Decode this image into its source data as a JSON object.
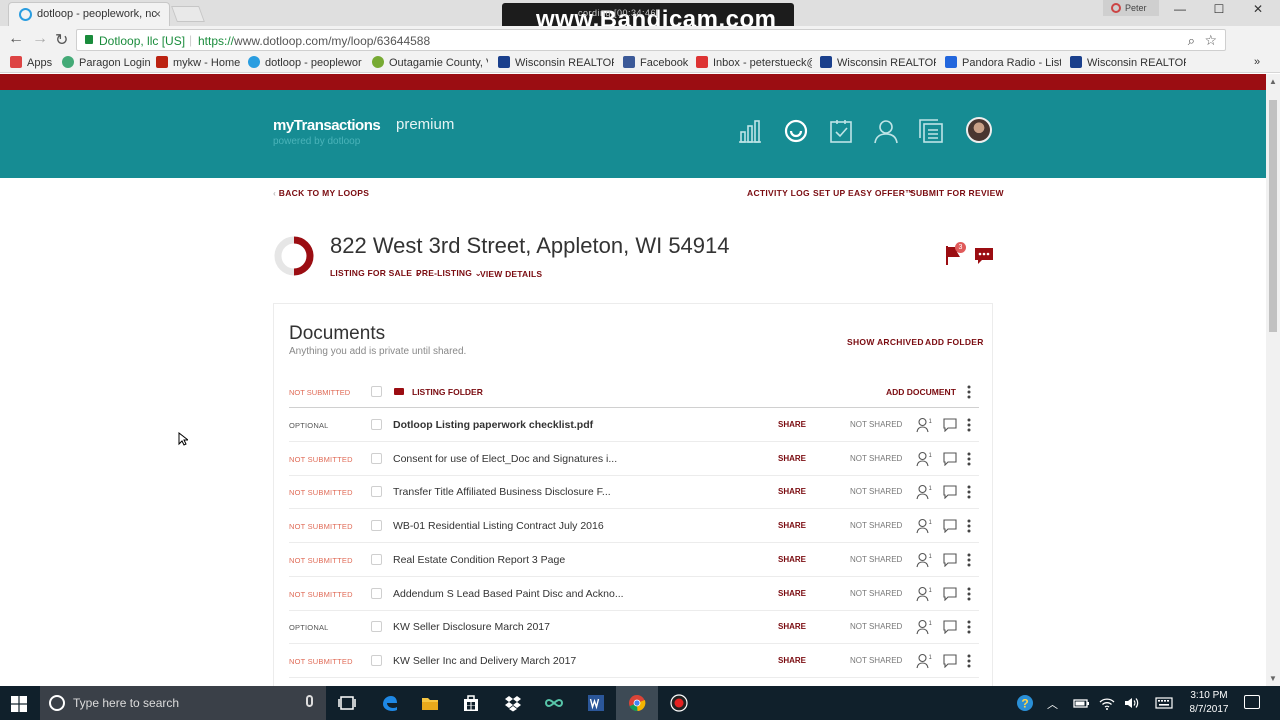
{
  "browser": {
    "tab_title": "dotloop - peoplework, nc",
    "tab_close": "×",
    "recorder_text": "www.Bandicam.com",
    "recorder_status": "cording [00:34:46]",
    "profile_name": "Peter",
    "window_controls": [
      "—",
      "☐",
      "✕"
    ],
    "back": "←",
    "forward": "→",
    "reload": "↻",
    "site_identity": "Dotloop, llc [US]",
    "url_scheme": "https://",
    "url_rest": "www.dotloop.com/my/loop/63644588",
    "menu": "⋮",
    "bookmarks": [
      {
        "label": "Apps",
        "icon": "apps-icon",
        "color": "#d44"
      },
      {
        "label": "Paragon Login",
        "icon": "paragon-icon",
        "color": "#4a7"
      },
      {
        "label": "mykw - Home",
        "icon": "kw-icon",
        "color": "#b21"
      },
      {
        "label": "dotloop - peoplewor",
        "icon": "dotloop-icon",
        "color": "#2a9de0"
      },
      {
        "label": "Outagamie County, V",
        "icon": "outagamie-icon",
        "color": "#7a3"
      },
      {
        "label": "Wisconsin REALTORS",
        "icon": "realtors-icon",
        "color": "#1a3f8c"
      },
      {
        "label": "Facebook",
        "icon": "facebook-icon",
        "color": "#3b5998"
      },
      {
        "label": "Inbox - peterstueck@",
        "icon": "gmail-icon",
        "color": "#d33"
      },
      {
        "label": "Wisconsin REALTORS",
        "icon": "realtors-icon",
        "color": "#1a3f8c"
      },
      {
        "label": "Pandora Radio - Liste",
        "icon": "pandora-icon",
        "color": "#2266dd"
      },
      {
        "label": "Wisconsin REALTORS",
        "icon": "realtors-icon",
        "color": "#1a3f8c"
      }
    ],
    "bookmarks_more": "»"
  },
  "app": {
    "brand": "myTransactions",
    "brand_sub": "powered by dotloop",
    "plan": "premium",
    "colors": {
      "header": "#168c93",
      "accent": "#7a0b10",
      "topbar": "#9b0d12",
      "not_submitted": "#e06b57"
    },
    "nav_icons": [
      "reports-icon",
      "loops-icon",
      "tasks-icon",
      "contacts-icon",
      "templates-icon"
    ]
  },
  "loop": {
    "back_link": "BACK TO MY LOOPS",
    "actions": [
      "ACTIVITY LOG",
      "SET UP EASY OFFER™",
      "SUBMIT FOR REVIEW"
    ],
    "address": "822 West 3rd Street, Appleton, WI 54914",
    "type": "LISTING FOR SALE",
    "status": "PRE-LISTING",
    "view_details": "VIEW DETAILS",
    "flag_count": "3"
  },
  "documents": {
    "title": "Documents",
    "subtitle": "Anything you add is private until shared.",
    "show_archived": "SHOW ARCHIVED",
    "add_folder": "ADD FOLDER",
    "folder": {
      "status": "NOT SUBMITTED",
      "name": "LISTING FOLDER",
      "add_document": "ADD DOCUMENT"
    },
    "rows": [
      {
        "status": "OPTIONAL",
        "name": "Dotloop Listing paperwork checklist.pdf",
        "share": "SHARE",
        "shared": "NOT SHARED",
        "participants": "1"
      },
      {
        "status": "NOT SUBMITTED",
        "name": "Consent for use of Elect_Doc and Signatures i...",
        "share": "SHARE",
        "shared": "NOT SHARED",
        "participants": "1"
      },
      {
        "status": "NOT SUBMITTED",
        "name": "Transfer Title Affiliated Business Disclosure F...",
        "share": "SHARE",
        "shared": "NOT SHARED",
        "participants": "1"
      },
      {
        "status": "NOT SUBMITTED",
        "name": "WB-01 Residential Listing Contract July 2016",
        "share": "SHARE",
        "shared": "NOT SHARED",
        "participants": "1"
      },
      {
        "status": "NOT SUBMITTED",
        "name": "Real Estate Condition Report 3 Page",
        "share": "SHARE",
        "shared": "NOT SHARED",
        "participants": "1"
      },
      {
        "status": "NOT SUBMITTED",
        "name": "Addendum S Lead Based Paint Disc and Ackno...",
        "share": "SHARE",
        "shared": "NOT SHARED",
        "participants": "1"
      },
      {
        "status": "OPTIONAL",
        "name": "KW Seller Disclosure March 2017",
        "share": "SHARE",
        "shared": "NOT SHARED",
        "participants": "1"
      },
      {
        "status": "NOT SUBMITTED",
        "name": "KW Seller Inc and Delivery March 2017",
        "share": "SHARE",
        "shared": "NOT SHARED",
        "participants": "1"
      }
    ]
  },
  "taskbar": {
    "search_placeholder": "Type here to search",
    "time": "3:10 PM",
    "date": "8/7/2017",
    "apps": [
      "task-view-icon",
      "edge-icon",
      "file-explorer-icon",
      "store-icon",
      "dropbox-icon",
      "infinity-icon",
      "word-icon",
      "chrome-icon",
      "recorder-icon"
    ]
  }
}
